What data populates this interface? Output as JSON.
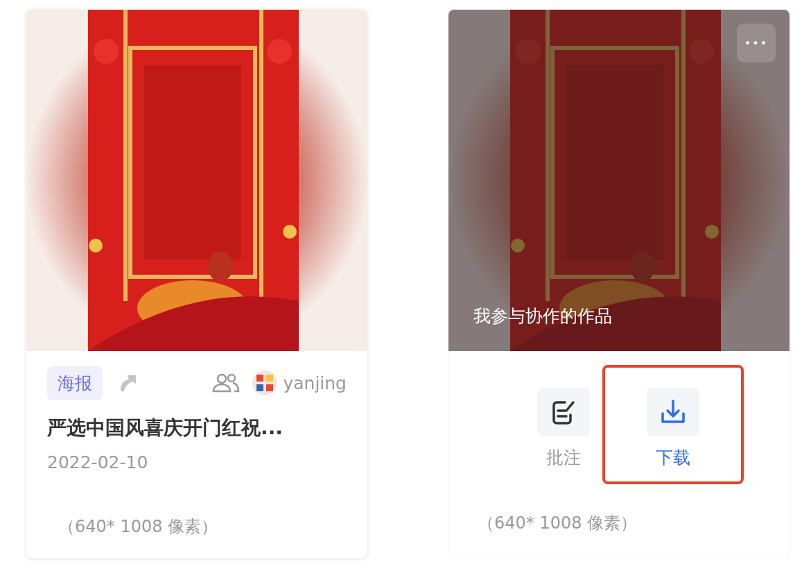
{
  "cards": [
    {
      "kind": "info",
      "overlay": false,
      "tag": "海报",
      "shared": true,
      "collaborative": true,
      "owner": "yanjing",
      "title": "严选中国风喜庆开门红祝...",
      "date": "2022-02-10",
      "size": "（640* 1008 像素）"
    },
    {
      "kind": "actions",
      "overlay": true,
      "caption": "我参与协作的作品",
      "more": "•••",
      "actions": [
        {
          "kind": "annotate",
          "label": "批注",
          "highlighted": false
        },
        {
          "kind": "download",
          "label": "下载",
          "highlighted": true
        }
      ],
      "size": "（640* 1008 像素）"
    }
  ]
}
